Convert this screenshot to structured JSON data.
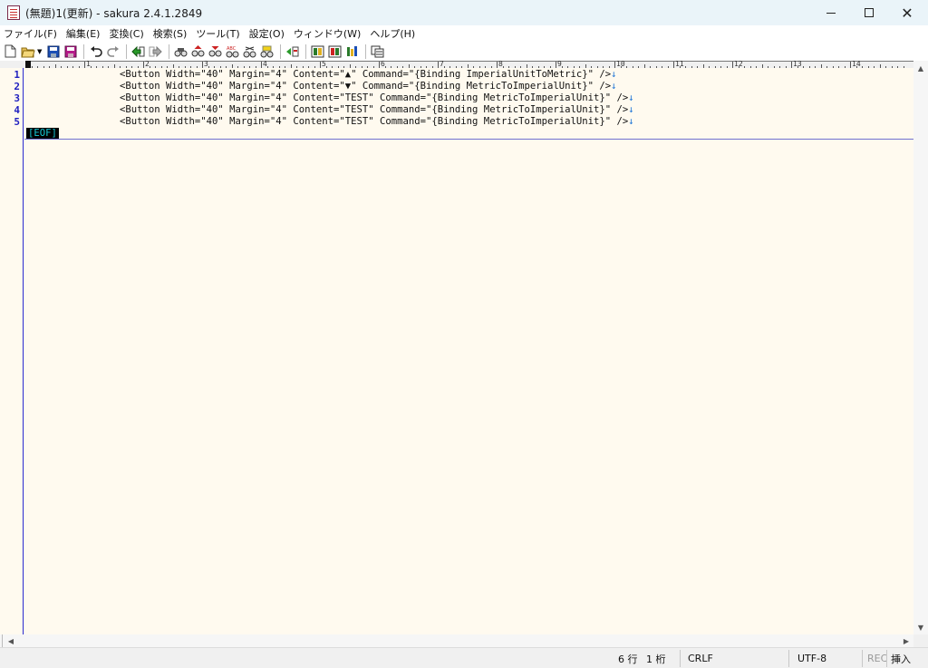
{
  "window": {
    "title": "(無題)1(更新) - sakura 2.4.1.2849",
    "minimize": "minimize",
    "maximize": "maximize",
    "close": "✕"
  },
  "menu": [
    "ファイル(F)",
    "編集(E)",
    "変換(C)",
    "検索(S)",
    "ツール(T)",
    "設定(O)",
    "ウィンドウ(W)",
    "ヘルプ(H)"
  ],
  "toolbar_icons": [
    "new-file-icon",
    "open-file-icon",
    "save-icon",
    "save-all-icon",
    "undo-icon",
    "redo-icon",
    "jump-back-icon",
    "jump-forward-icon",
    "search-icon",
    "search-prev-icon",
    "search-next-icon",
    "grep-icon",
    "replace-icon",
    "find-marker-icon",
    "outline-icon",
    "compare-icon",
    "tag-jump-icon",
    "window-list-icon"
  ],
  "ruler": {
    "numbers": [
      "1",
      "2",
      "3",
      "4",
      "5",
      "6",
      "7",
      "8",
      "9",
      "10",
      "11",
      "12",
      "13",
      "14"
    ]
  },
  "editor": {
    "line_numbers": [
      "1",
      "2",
      "3",
      "4",
      "5"
    ],
    "lines": [
      "<Button Width=\"40\" Margin=\"4\" Content=\"▲\" Command=\"{Binding ImperialUnitToMetric}\" />",
      "<Button Width=\"40\" Margin=\"4\" Content=\"▼\" Command=\"{Binding MetricToImperialUnit}\" />",
      "<Button Width=\"40\" Margin=\"4\" Content=\"TEST\" Command=\"{Binding MetricToImperialUnit}\" />",
      "<Button Width=\"40\" Margin=\"4\" Content=\"TEST\" Command=\"{Binding MetricToImperialUnit}\" />",
      "<Button Width=\"40\" Margin=\"4\" Content=\"TEST\" Command=\"{Binding MetricToImperialUnit}\" />"
    ],
    "eol_mark": "↓",
    "eof_mark": "[EOF]"
  },
  "status": {
    "row": "6 行",
    "col": "1 桁",
    "newline": "CRLF",
    "encoding": "UTF-8",
    "rec": "REC",
    "mode": "挿入"
  },
  "colors": {
    "editor_bg": "#fffaef",
    "line_number": "#2020c0",
    "eol_mark": "#1e74d6",
    "eof_bg": "#000000",
    "eof_fg": "#17c9d6"
  }
}
